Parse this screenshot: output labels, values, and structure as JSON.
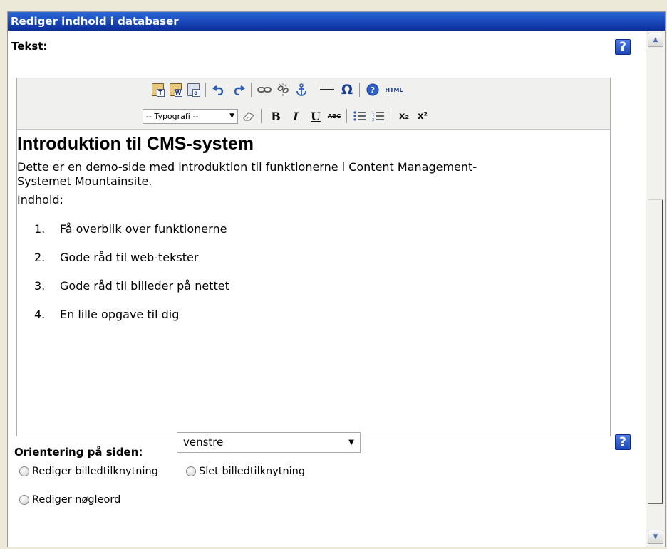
{
  "window": {
    "title": "Rediger indhold i databaser"
  },
  "form": {
    "tekst_label": "Tekst:",
    "help_glyph": "?",
    "orientering_label": "Orientering på siden:",
    "orientering_value": "venstre",
    "radio_options": [
      {
        "label": "Rediger billedtilknytning"
      },
      {
        "label": "Slet billedtilknytning"
      },
      {
        "label": "Rediger nøgleord"
      }
    ]
  },
  "toolbar": {
    "row1_icons": [
      "paste-text-icon",
      "paste-word-icon",
      "select-all-icon",
      "undo-icon",
      "redo-icon",
      "link-icon",
      "unlink-icon",
      "anchor-icon",
      "horizontal-rule-icon",
      "special-char-icon",
      "help-icon",
      "html-source-icon"
    ],
    "paste_text_glyph": "T",
    "paste_word_glyph": "W",
    "select_all_glyph": "a",
    "html_label": "HTML",
    "typografi_label": "-- Typografi --",
    "bold_label": "B",
    "italic_label": "I",
    "underline_label": "U",
    "strike_label": "ABC",
    "subscript_label": "x₂",
    "superscript_label": "x²"
  },
  "document": {
    "heading": "Introduktion til CMS-system",
    "intro": "Dette er en demo-side med introduktion til funktionerne i Content Management-Systemet Mountainsite.",
    "indhold_label": "Indhold:",
    "list": [
      {
        "num": "1.",
        "text": "Få overblik over funktionerne"
      },
      {
        "num": "2.",
        "text": "Gode råd til web-tekster"
      },
      {
        "num": "3.",
        "text": "Gode råd til billeder på nettet"
      },
      {
        "num": "4.",
        "text": "En lille opgave til dig"
      }
    ]
  },
  "colors": {
    "titlebar": "#1c4cbd",
    "background": "#ece9d8",
    "toolbar_bg": "#f0f0ee"
  }
}
